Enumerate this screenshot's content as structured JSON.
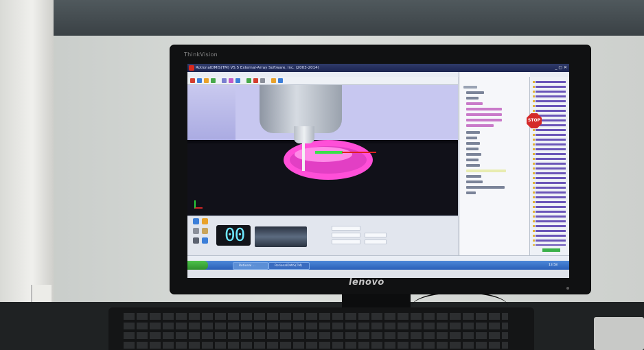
{
  "monitor": {
    "top_brand": "ThinkVision",
    "bottom_brand": "lenovo"
  },
  "app": {
    "title": "RotionalDMIS(TM) V5.5   External-Array Software, Inc. (2003-2014)",
    "window_buttons": "_ ▢ ✕"
  },
  "panel": {
    "counter": "00",
    "progress_fraction": 0.0
  },
  "overlay": {
    "stop_label": "STOP"
  },
  "taskbar": {
    "tasks": [
      "Rotional ... ",
      "RotionalDMIS(TM)"
    ],
    "clock": "13:58"
  },
  "colors": {
    "bowl": "#ff4fd8",
    "viewport_bg": "#1f2a66",
    "counter_digits": "#6ee8ff",
    "taskbar": "#2a5fb8"
  }
}
